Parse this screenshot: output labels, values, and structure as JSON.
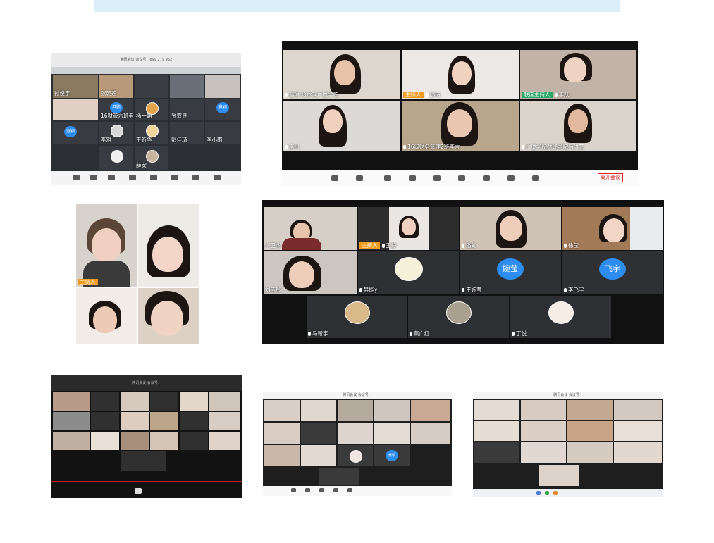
{
  "photo1": {
    "meeting_title": "腾讯会议 会议号：899 279 952",
    "labels": [
      "孙俊宇",
      "张乾莲",
      "16财管六班尹鹏",
      "杨士朝",
      "张双显",
      "李雅",
      "王新华",
      "彭佳琦",
      "李小雨",
      "薛安"
    ],
    "avatar_names": [
      "尹鹏",
      "冠颖",
      "黄颖"
    ]
  },
  "photo2": {
    "tiles": [
      {
        "name": "葛琳 哈尔滨广厦学院",
        "badge": ""
      },
      {
        "name": "邵琦",
        "badge": "主持人"
      },
      {
        "name": "李跃",
        "badge": "联席主持人"
      },
      {
        "name": "李川",
        "badge": ""
      },
      {
        "name": "16级财务管理2班李言",
        "badge": ""
      },
      {
        "name": "广厦学院财经学院马洪慧",
        "badge": ""
      }
    ],
    "leave_button": "离开会议"
  },
  "photo3": {
    "badge": "主持人"
  },
  "photo4": {
    "tiles": [
      {
        "name": "卢卫华",
        "badge": ""
      },
      {
        "name": "王静",
        "badge": "主持人"
      },
      {
        "name": "潘虹",
        "badge": ""
      },
      {
        "name": "徐莹",
        "badge": ""
      },
      {
        "name": "刘苇彤",
        "badge": ""
      },
      {
        "name": "异能yi",
        "badge": ""
      },
      {
        "name": "王婉莹",
        "badge": "",
        "avatar": "婉莹"
      },
      {
        "name": "李飞宇",
        "badge": "",
        "avatar": "飞宇"
      },
      {
        "name": "马新宇",
        "badge": ""
      },
      {
        "name": "焦广红",
        "badge": ""
      },
      {
        "name": "丁悦",
        "badge": ""
      }
    ]
  },
  "photo5": {
    "meeting_title": "腾讯会议 会议号："
  },
  "photo6": {
    "meeting_title": "腾讯会议 会议号：",
    "avatar": "黄颖"
  },
  "photo7": {
    "meeting_title": "腾讯会议 会议号："
  },
  "colors": {
    "zoom_bg": "#2b2b2b",
    "host_badge": "#f29c1f",
    "cohost_badge": "#2aa86a",
    "avatar_blue": "#2d8cf0",
    "leave_red": "#d9251d"
  }
}
